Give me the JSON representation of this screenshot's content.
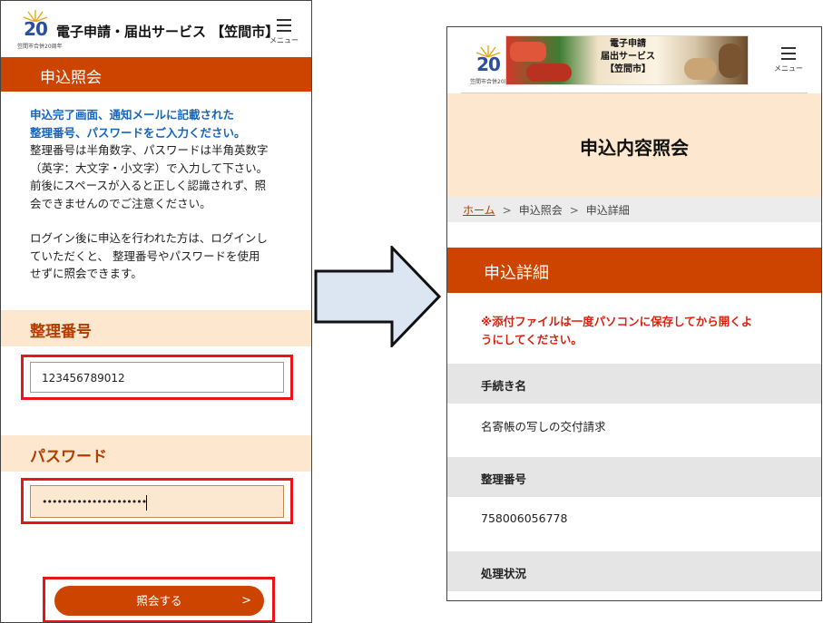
{
  "left_screen": {
    "logo": {
      "number": "20",
      "tagline": "笠間市合併20周年"
    },
    "header_title": "電子申請・届出サービス 【笠間市】",
    "menu_label": "メニュー",
    "banner_title": "申込照会",
    "instruction": {
      "highlight_line1": "申込完了画面、通知メールに記載された",
      "highlight_line2": "整理番号、パスワードをご入力ください。",
      "line1": "整理番号は半角数字、パスワードは半角英数字",
      "line2": "（英字：大文字・小文字）で入力して下さい。",
      "line3": "前後にスペースが入ると正しく認識されず、照",
      "line4": "会できませんのでご注意ください。",
      "line5": "ログイン後に申込を行われた方は、ログインし",
      "line6": "ていただくと、 整理番号やパスワードを使用",
      "line7": "せずに照会できます。"
    },
    "reference_number": {
      "label": "整理番号",
      "value": "123456789012"
    },
    "password": {
      "label": "パスワード",
      "masked_value": "•••••••••••••••••••••"
    },
    "submit_button": {
      "label": "照会する",
      "arrow": ">"
    }
  },
  "right_screen": {
    "logo": {
      "number": "20",
      "tagline": "笠間市合併20周年"
    },
    "banner": {
      "line1": "電子申請",
      "line2": "届出サービス",
      "line3": "【笠間市】"
    },
    "menu_label": "メニュー",
    "page_title": "申込内容照会",
    "breadcrumb": {
      "home": "ホーム",
      "sep": ">",
      "step2": "申込照会",
      "step3": "申込詳細"
    },
    "detail_title": "申込詳細",
    "notice_line1": "※添付ファイルは一度パソコンに保存してから開くよ",
    "notice_line2": "うにしてください。",
    "rows": [
      {
        "label": "手続き名",
        "value": "名寄帳の写しの交付請求"
      },
      {
        "label": "整理番号",
        "value": "758006056778"
      },
      {
        "label": "処理状況",
        "value": ""
      }
    ]
  },
  "colors": {
    "accent_orange": "#cc4400",
    "highlight_red": "#e8141a",
    "band_peach": "#fde8cf",
    "instruction_blue": "#1565c0",
    "arrow_fill": "#dce6f2"
  }
}
